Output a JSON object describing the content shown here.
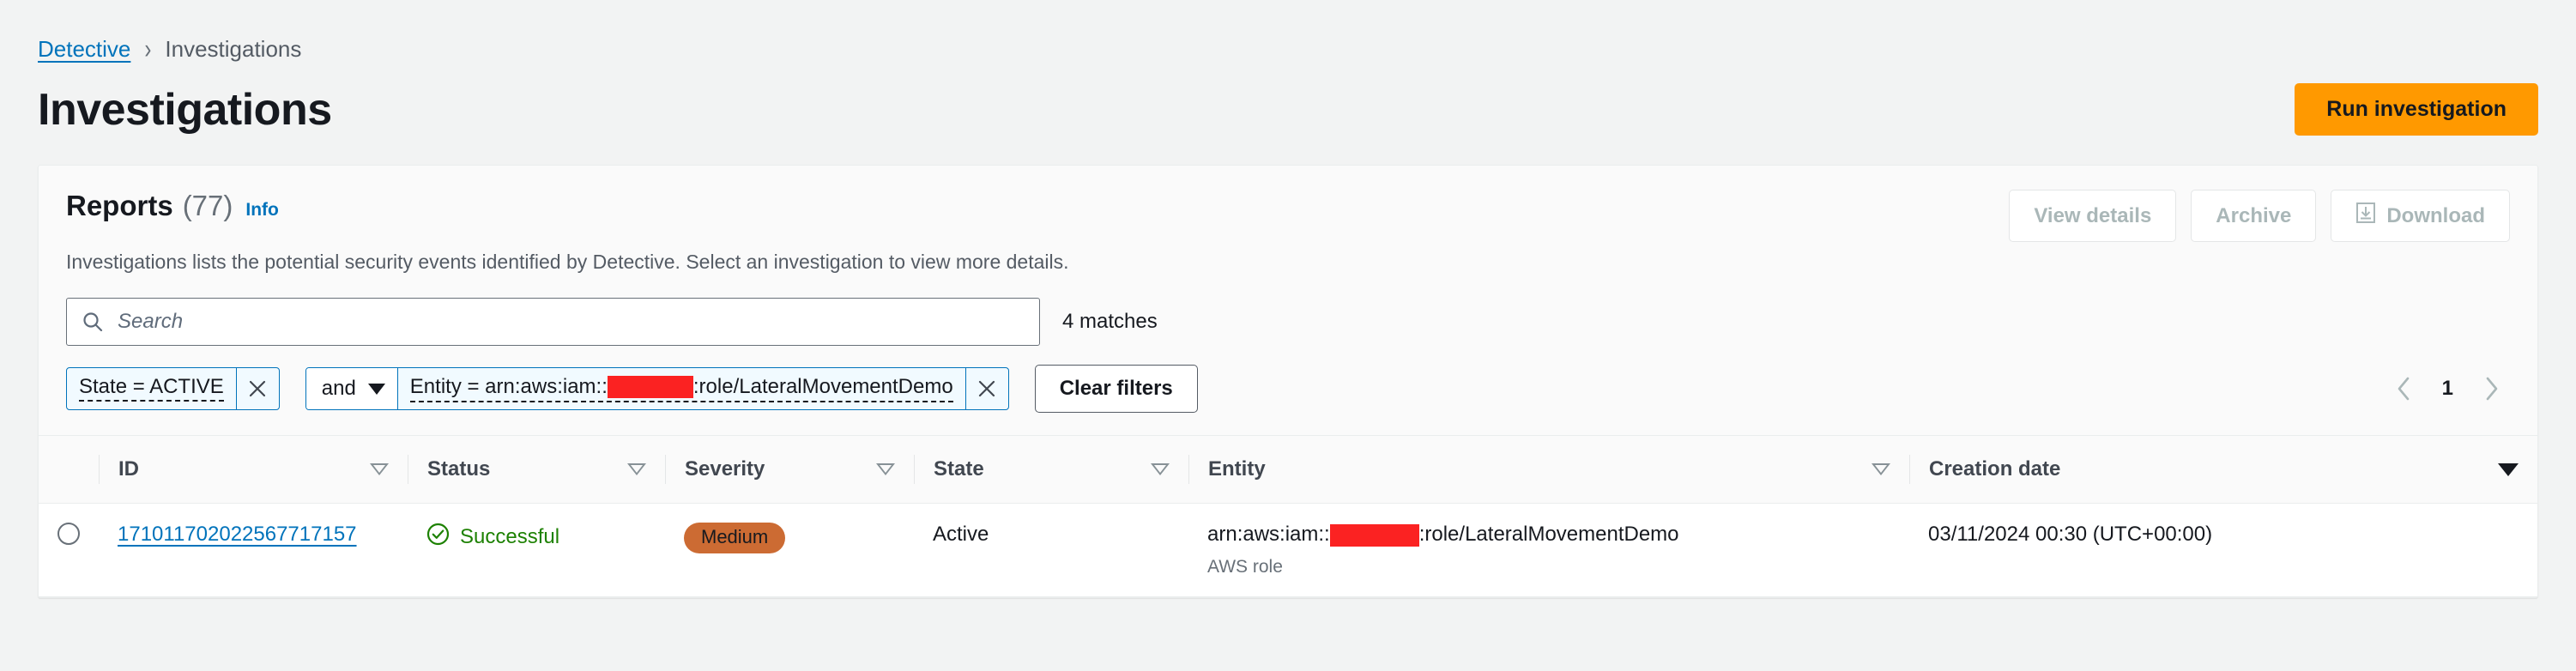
{
  "breadcrumb": {
    "root": "Detective",
    "current": "Investigations"
  },
  "header": {
    "title": "Investigations",
    "primary_button": "Run investigation"
  },
  "card": {
    "title": "Reports",
    "count": "(77)",
    "info": "Info",
    "description": "Investigations lists the potential security events identified by Detective. Select an investigation to view more details.",
    "actions": [
      {
        "label": "View details",
        "icon": null,
        "disabled": true
      },
      {
        "label": "Archive",
        "icon": null,
        "disabled": true
      },
      {
        "label": "Download",
        "icon": "download-icon",
        "disabled": true
      }
    ]
  },
  "search": {
    "placeholder": "Search",
    "value": "",
    "icon": "search-icon",
    "matches": "4 matches"
  },
  "filters": {
    "tokens": [
      {
        "label": "State = ACTIVE",
        "remove_icon": "close-icon"
      }
    ],
    "join_operator": "and",
    "join_icon": "chevron-down-icon",
    "entity_token": {
      "prefix": "Entity = arn:aws:iam::",
      "redacted": true,
      "suffix": ":role/LateralMovementDemo",
      "remove_icon": "close-icon"
    },
    "clear_label": "Clear filters"
  },
  "pagination": {
    "prev_icon": "chevron-left-icon",
    "next_icon": "chevron-right-icon",
    "current_page": "1"
  },
  "table": {
    "columns": [
      {
        "label": "ID",
        "sort": "hollow"
      },
      {
        "label": "Status",
        "sort": "hollow"
      },
      {
        "label": "Severity",
        "sort": "hollow"
      },
      {
        "label": "State",
        "sort": "hollow"
      },
      {
        "label": "Entity",
        "sort": "hollow"
      },
      {
        "label": "Creation date",
        "sort": "filled"
      }
    ],
    "rows": [
      {
        "id": "171011702022567717157",
        "status": "Successful",
        "status_icon": "check-circle-icon",
        "severity": "Medium",
        "state": "Active",
        "entity_prefix": "arn:aws:iam::",
        "entity_suffix": ":role/LateralMovementDemo",
        "entity_type": "AWS role",
        "creation_date": "03/11/2024 00:30 (UTC+00:00)"
      }
    ]
  },
  "colors": {
    "accent_orange": "#ff9900",
    "link_blue": "#0073bb",
    "success_green": "#1d8102",
    "severity_medium": "#cc6b33",
    "redaction_red": "#fb2222"
  }
}
